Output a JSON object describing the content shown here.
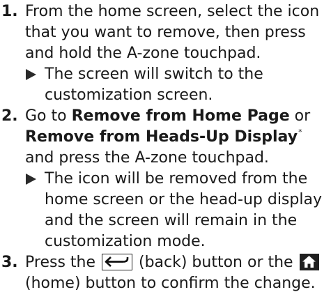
{
  "steps": [
    {
      "number": "1.",
      "text": "From the home screen, select the icon that you want to remove, then press and hold the A-zone touchpad.",
      "result": "The screen will switch to the customization screen."
    },
    {
      "number": "2.",
      "text_before": "Go to ",
      "bold_1": "Remove from Home Page",
      "text_mid": " or ",
      "bold_2": "Remove from Heads-Up Display",
      "footnote_mark": "*",
      "text_after": " and press the A-zone touchpad.",
      "result": "The icon will be removed from the home screen or the head-up display and the screen will remain in the customization mode."
    },
    {
      "number": "3.",
      "text_before": "Press the ",
      "back_icon": "back-arrow-icon",
      "text_mid": " (back) button or the ",
      "home_icon": "home-icon",
      "text_after": " (home) button to confirm the change."
    }
  ]
}
